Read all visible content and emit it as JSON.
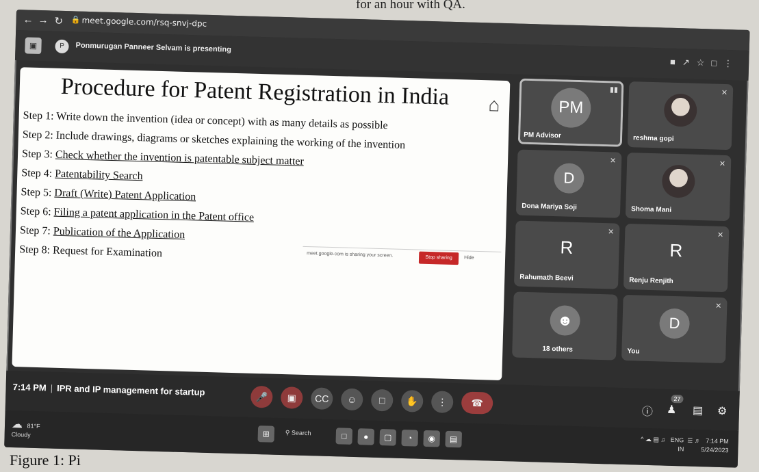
{
  "page_top_text": "for an hour with QA.",
  "caption": "Figure 1: Pi",
  "browser": {
    "url": "meet.google.com/rsq-snvj-dpc"
  },
  "meet": {
    "presenting_text": "Ponmurugan Panneer Selvam is presenting",
    "presenter_initial": "P"
  },
  "slide": {
    "title": "Procedure for Patent Registration in India",
    "steps": [
      {
        "prefix": "Step 1: ",
        "text": "Write down the invention (idea or concept) with as many details as possible",
        "underline": false
      },
      {
        "prefix": "Step 2: ",
        "text": "Include drawings, diagrams or sketches explaining the working of the invention",
        "underline": false
      },
      {
        "prefix": "Step 3: ",
        "text": "Check whether the invention is patentable subject matter",
        "underline": true
      },
      {
        "prefix": "Step 4: ",
        "text": "Patentability Search",
        "underline": true
      },
      {
        "prefix": "Step 5: ",
        "text": "Draft (Write) Patent Application",
        "underline": true
      },
      {
        "prefix": "Step 6: ",
        "text": "Filing a patent application in the Patent office",
        "underline": true
      },
      {
        "prefix": "Step 7: ",
        "text": "Publication of the Application",
        "underline": true
      },
      {
        "prefix": "Step 8: ",
        "text": "Request for Examination",
        "underline": false
      }
    ],
    "share_message": "meet.google.com is sharing your screen.",
    "stop_label": "Stop sharing",
    "hide_label": "Hide"
  },
  "participants": [
    {
      "name": "PM Advisor",
      "initials": "PM"
    },
    {
      "name": "reshma gopi"
    },
    {
      "name": "Dona Mariya Soji",
      "initials": "D"
    },
    {
      "name": "Shoma Mani"
    },
    {
      "name": "Rahumath Beevi",
      "initials": "R"
    },
    {
      "name": "Renju Renjith",
      "initials": "R"
    },
    {
      "name": "18 others"
    },
    {
      "name": "You",
      "initials": "D"
    }
  ],
  "meeting": {
    "time": "7:14 PM",
    "title": "IPR and IP management for startup",
    "people_count": "27"
  },
  "taskbar": {
    "weather_temp": "81°F",
    "weather_desc": "Cloudy",
    "search_label": "Search",
    "lang": "ENG",
    "region": "IN",
    "clock_time": "7:14 PM",
    "clock_date": "5/24/2023"
  },
  "colors": {
    "stop_button": "#c62828",
    "end_call": "#9b3d3d"
  }
}
